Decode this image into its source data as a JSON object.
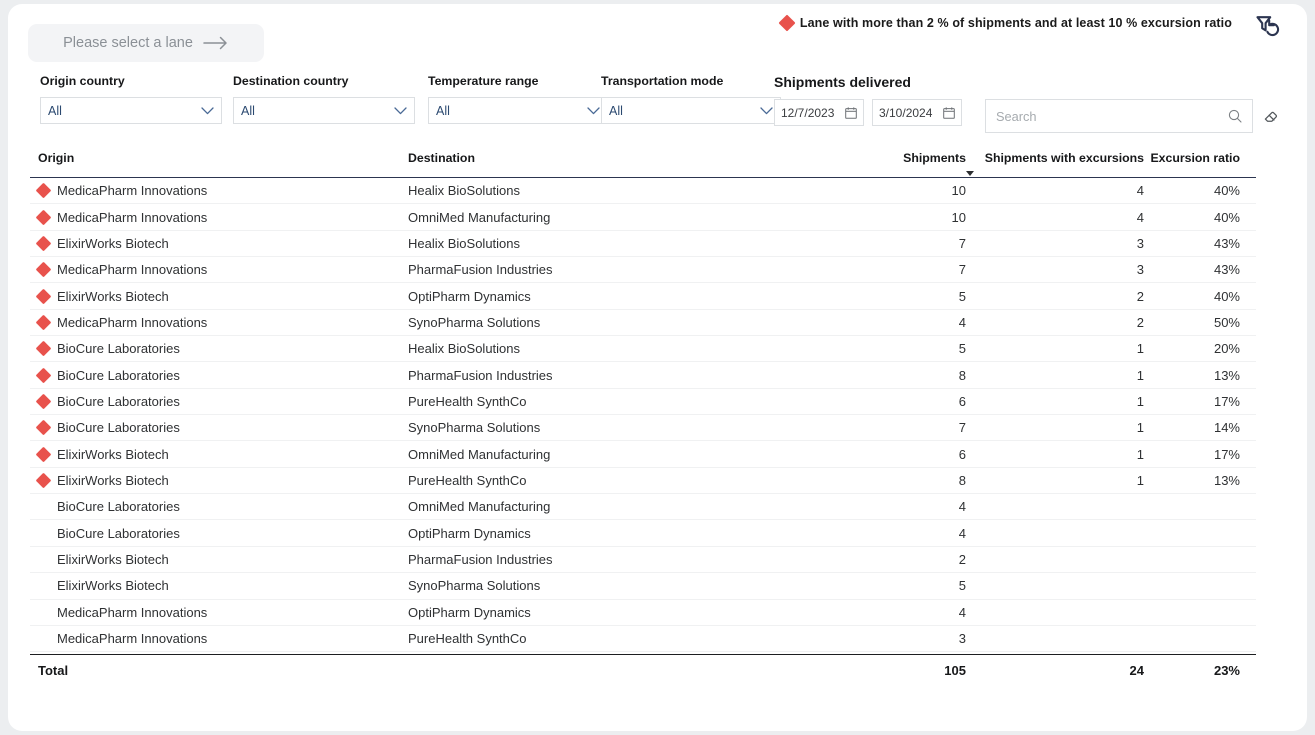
{
  "legend": {
    "icon": "red-diamond-marker",
    "text": "Lane with more than 2 % of shipments and at least 10 % excursion ratio"
  },
  "brand": {
    "icon": "filter-reset-logo-icon"
  },
  "lane_selector": {
    "label": "Please select a lane",
    "arrow_icon": "arrow-right-icon"
  },
  "filters": [
    {
      "label": "Origin country",
      "value": "All"
    },
    {
      "label": "Destination country",
      "value": "All"
    },
    {
      "label": "Temperature range",
      "value": "All"
    },
    {
      "label": "Transportation mode",
      "value": "All"
    }
  ],
  "dates": {
    "title": "Shipments delivered",
    "from": "12/7/2023",
    "to": "3/10/2024",
    "calendar_icon": "calendar-icon"
  },
  "search": {
    "placeholder": "Search",
    "value": "",
    "icon": "search-icon",
    "clear_icon": "eraser-icon"
  },
  "table": {
    "columns": [
      "Origin",
      "Destination",
      "Shipments",
      "Shipments with excursions",
      "Excursion ratio"
    ],
    "sorted_column_index": 3,
    "sort_direction": "descending",
    "rows": [
      {
        "flagged": true,
        "origin": "MedicaPharm Innovations",
        "destination": "Healix BioSolutions",
        "shipments": "10",
        "excursions": "4",
        "ratio": "40%"
      },
      {
        "flagged": true,
        "origin": "MedicaPharm Innovations",
        "destination": "OmniMed Manufacturing",
        "shipments": "10",
        "excursions": "4",
        "ratio": "40%"
      },
      {
        "flagged": true,
        "origin": "ElixirWorks Biotech",
        "destination": "Healix BioSolutions",
        "shipments": "7",
        "excursions": "3",
        "ratio": "43%"
      },
      {
        "flagged": true,
        "origin": "MedicaPharm Innovations",
        "destination": "PharmaFusion Industries",
        "shipments": "7",
        "excursions": "3",
        "ratio": "43%"
      },
      {
        "flagged": true,
        "origin": "ElixirWorks Biotech",
        "destination": "OptiPharm Dynamics",
        "shipments": "5",
        "excursions": "2",
        "ratio": "40%"
      },
      {
        "flagged": true,
        "origin": "MedicaPharm Innovations",
        "destination": "SynoPharma Solutions",
        "shipments": "4",
        "excursions": "2",
        "ratio": "50%"
      },
      {
        "flagged": true,
        "origin": "BioCure Laboratories",
        "destination": "Healix BioSolutions",
        "shipments": "5",
        "excursions": "1",
        "ratio": "20%"
      },
      {
        "flagged": true,
        "origin": "BioCure Laboratories",
        "destination": "PharmaFusion Industries",
        "shipments": "8",
        "excursions": "1",
        "ratio": "13%"
      },
      {
        "flagged": true,
        "origin": "BioCure Laboratories",
        "destination": "PureHealth SynthCo",
        "shipments": "6",
        "excursions": "1",
        "ratio": "17%"
      },
      {
        "flagged": true,
        "origin": "BioCure Laboratories",
        "destination": "SynoPharma Solutions",
        "shipments": "7",
        "excursions": "1",
        "ratio": "14%"
      },
      {
        "flagged": true,
        "origin": "ElixirWorks Biotech",
        "destination": "OmniMed Manufacturing",
        "shipments": "6",
        "excursions": "1",
        "ratio": "17%"
      },
      {
        "flagged": true,
        "origin": "ElixirWorks Biotech",
        "destination": "PureHealth SynthCo",
        "shipments": "8",
        "excursions": "1",
        "ratio": "13%"
      },
      {
        "flagged": false,
        "origin": "BioCure Laboratories",
        "destination": "OmniMed Manufacturing",
        "shipments": "4",
        "excursions": "",
        "ratio": ""
      },
      {
        "flagged": false,
        "origin": "BioCure Laboratories",
        "destination": "OptiPharm Dynamics",
        "shipments": "4",
        "excursions": "",
        "ratio": ""
      },
      {
        "flagged": false,
        "origin": "ElixirWorks Biotech",
        "destination": "PharmaFusion Industries",
        "shipments": "2",
        "excursions": "",
        "ratio": ""
      },
      {
        "flagged": false,
        "origin": "ElixirWorks Biotech",
        "destination": "SynoPharma Solutions",
        "shipments": "5",
        "excursions": "",
        "ratio": ""
      },
      {
        "flagged": false,
        "origin": "MedicaPharm Innovations",
        "destination": "OptiPharm Dynamics",
        "shipments": "4",
        "excursions": "",
        "ratio": ""
      },
      {
        "flagged": false,
        "origin": "MedicaPharm Innovations",
        "destination": "PureHealth SynthCo",
        "shipments": "3",
        "excursions": "",
        "ratio": ""
      }
    ],
    "total": {
      "label": "Total",
      "destination": "",
      "shipments": "105",
      "excursions": "24",
      "ratio": "23%"
    }
  },
  "colors": {
    "flag_red": "#e8524c",
    "header_rule": "#2c3550",
    "brand_navy": "#2c3550",
    "select_text": "#2b4970"
  }
}
